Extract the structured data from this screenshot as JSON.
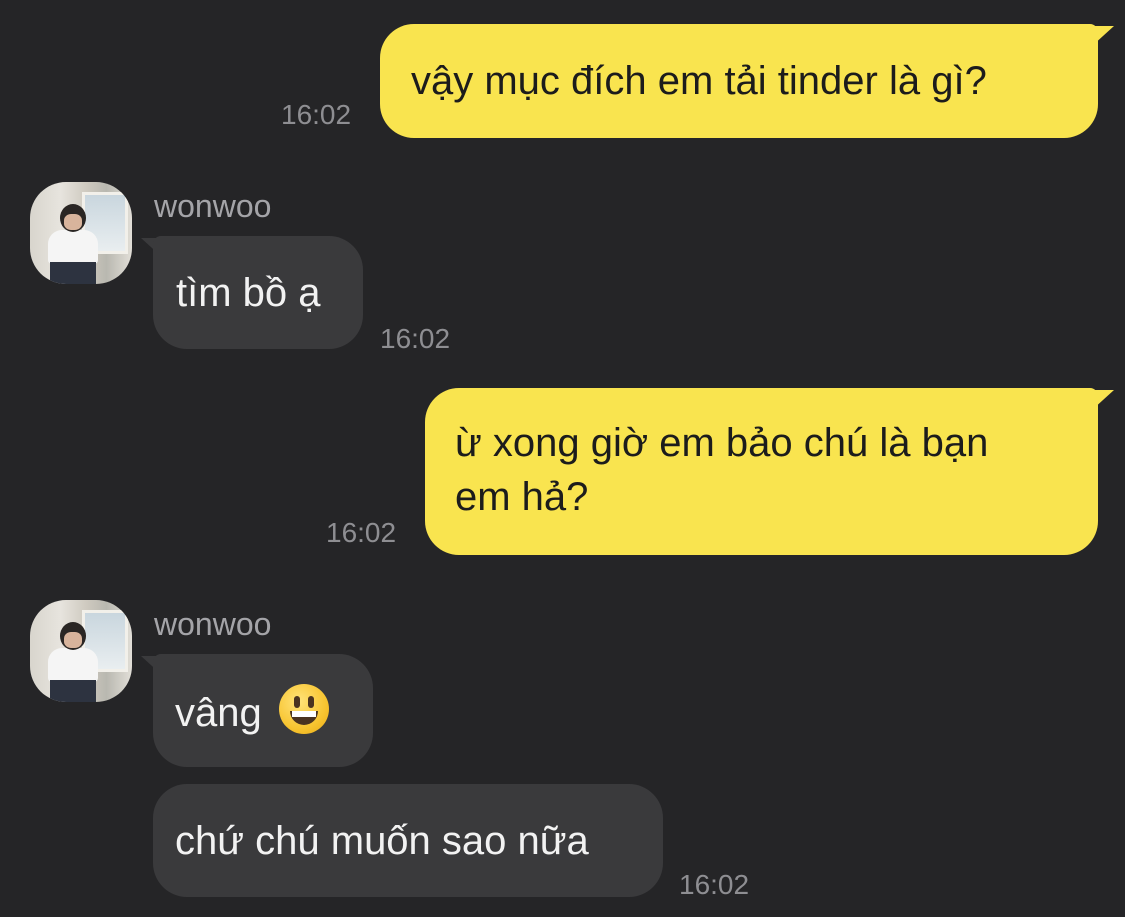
{
  "messages": [
    {
      "direction": "out",
      "text": "vậy mục đích em tải tinder là gì?",
      "time": "16:02"
    },
    {
      "direction": "in",
      "sender": "wonwoo",
      "text": "tìm bồ ạ",
      "time": "16:02"
    },
    {
      "direction": "out",
      "text_lines": [
        "ừ xong giờ em bảo chú là bạn",
        "em hả?"
      ],
      "time": "16:02"
    },
    {
      "direction": "in",
      "sender": "wonwoo",
      "text": "vâng",
      "emoji": "grinning-face-icon"
    },
    {
      "direction": "in",
      "text": "chứ chú muốn sao nữa",
      "time": "16:02"
    }
  ],
  "colors": {
    "background": "#252527",
    "outgoing_bubble": "#f9e44f",
    "incoming_bubble": "#3a3a3c",
    "timestamp": "#8e8e92"
  }
}
